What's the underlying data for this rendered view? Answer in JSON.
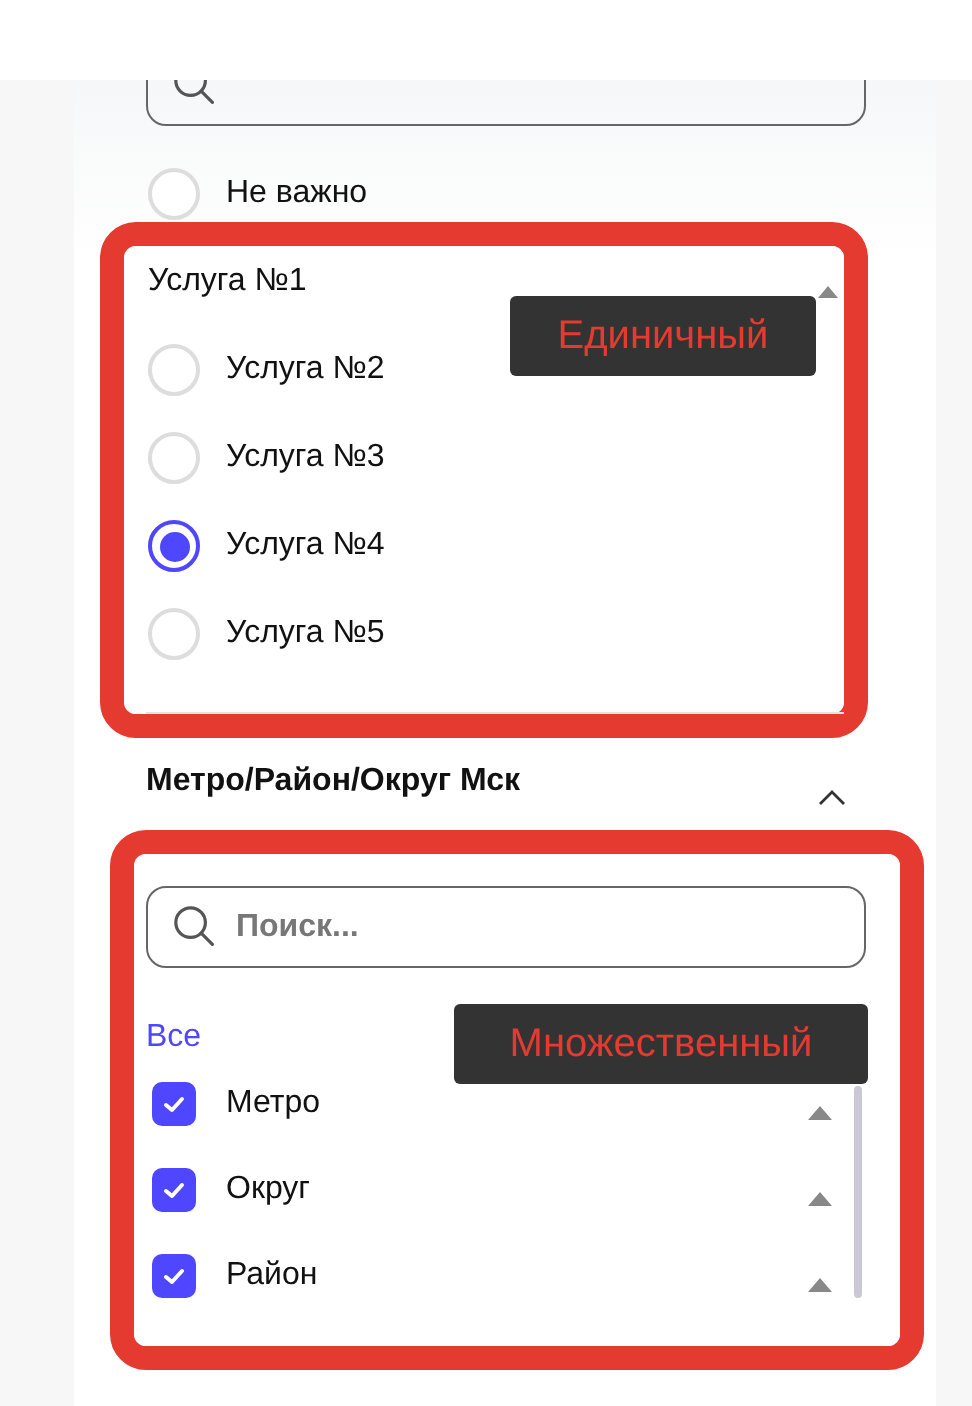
{
  "top_search": {
    "kind": "search"
  },
  "any_option": {
    "label": "Не важно",
    "selected": false
  },
  "services": {
    "annotation": "Единичный",
    "items": [
      {
        "kind": "text",
        "label": "Услуга №1"
      },
      {
        "kind": "radio",
        "label": "Услуга №2",
        "selected": false
      },
      {
        "kind": "radio",
        "label": "Услуга №3",
        "selected": false
      },
      {
        "kind": "radio",
        "label": "Услуга №4",
        "selected": true
      },
      {
        "kind": "radio",
        "label": "Услуга №5",
        "selected": false
      }
    ]
  },
  "district": {
    "title": "Метро/Район/Округ Мск",
    "expanded": true,
    "annotation": "Множественный",
    "search": {
      "placeholder": "Поиск..."
    },
    "select_all": "Все",
    "items": [
      {
        "label": "Метро",
        "checked": true
      },
      {
        "label": "Округ",
        "checked": true
      },
      {
        "label": "Район",
        "checked": true
      }
    ]
  }
}
